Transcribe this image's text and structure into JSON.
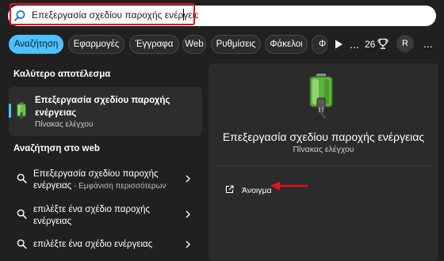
{
  "search": {
    "value": "Επεξεργασία σχεδίου παροχής ενέργειας"
  },
  "tabs": [
    {
      "label": "Αναζήτηση",
      "active": true
    },
    {
      "label": "Εφαρμογές",
      "active": false
    },
    {
      "label": "Έγγραφα",
      "active": false
    },
    {
      "label": "Web",
      "active": false
    },
    {
      "label": "Ρυθμίσεις",
      "active": false
    },
    {
      "label": "Φάκελοι",
      "active": false
    },
    {
      "label": "Φ",
      "active": false
    }
  ],
  "toolbar": {
    "points": "26",
    "avatar_initial": "R",
    "more": "...",
    "menu": "..."
  },
  "best_match": {
    "section_title": "Καλύτερο αποτέλεσμα",
    "name": "Επεξεργασία σχεδίου παροχής ενέργειας",
    "subtitle": "Πίνακας ελέγχου"
  },
  "web": {
    "section_title": "Αναζήτηση στο web",
    "results": [
      {
        "text": "Επεξεργασία σχεδίου παροχής ενέργειας",
        "extra": " - Εμφάνιση περισσότερων"
      },
      {
        "text": "επιλέξτε ένα σχέδιο παροχής ενέργειας",
        "extra": ""
      },
      {
        "text": "επιλέξτε ένα σχέδιο ενέργειας",
        "extra": ""
      }
    ]
  },
  "detail": {
    "title": "Επεξεργασία σχεδίου παροχής ενέργειας",
    "subtitle": "Πίνακας ελέγχου",
    "open_label": "Άνοιγμα"
  },
  "colors": {
    "accent": "#4cc2ff",
    "highlight": "#e5121c",
    "background": "#202020",
    "panel": "#2b2b2b"
  },
  "icons": {
    "search": "search-icon",
    "battery": "battery-plug-icon",
    "open": "open-external-icon",
    "chevron": "chevron-right-icon",
    "trophy": "trophy-icon",
    "play": "play-icon"
  }
}
